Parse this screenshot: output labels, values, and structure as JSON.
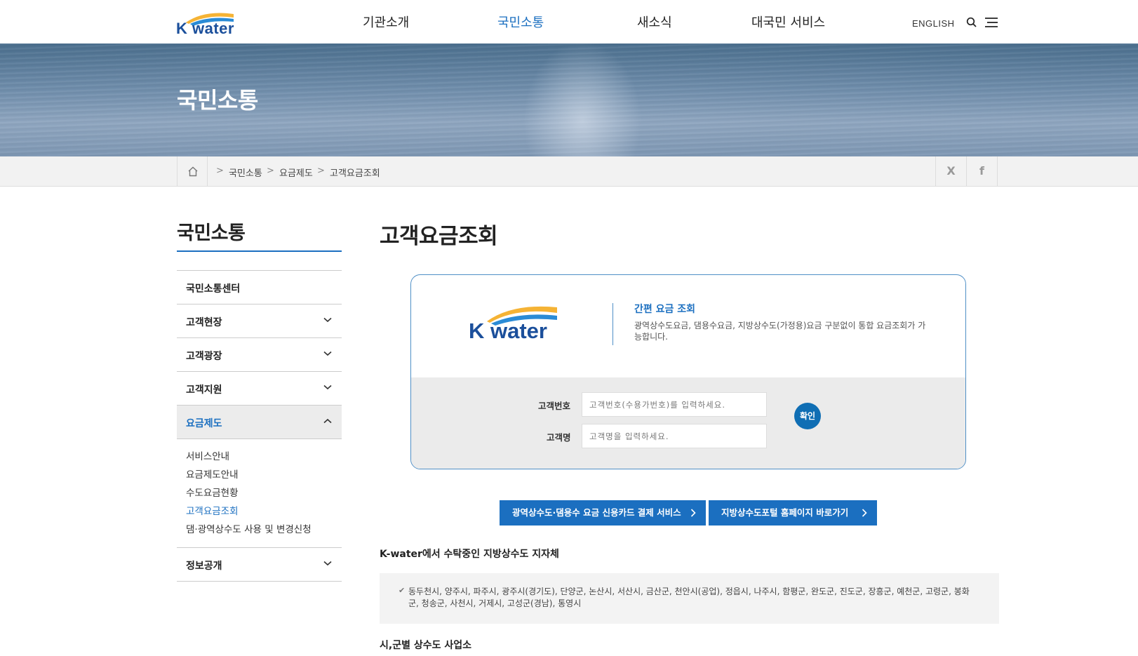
{
  "header": {
    "logo_text": "K water",
    "nav": [
      "기관소개",
      "국민소통",
      "새소식",
      "대국민 서비스"
    ],
    "active_nav_index": 1,
    "english_label": "ENGLISH"
  },
  "hero": {
    "title": "국민소통"
  },
  "breadcrumb": {
    "items": [
      "국민소통",
      "요금제도",
      "고객요금조회"
    ],
    "separator": ">",
    "share": {
      "x_label": "X",
      "facebook_label": "f"
    }
  },
  "sidebar": {
    "title": "국민소통",
    "items": [
      {
        "label": "국민소통센터"
      },
      {
        "label": "고객현장"
      },
      {
        "label": "고객광장"
      },
      {
        "label": "고객지원"
      },
      {
        "label": "요금제도"
      },
      {
        "label": "정보공개"
      }
    ],
    "sub_items": [
      "서비스안내",
      "요금제도안내",
      "수도요금현황",
      "고객요금조회",
      "댐·광역상수도 사용 및 변경신청"
    ],
    "active_sub_index": 3
  },
  "main": {
    "page_title": "고객요금조회",
    "lookup": {
      "logo_text": "K water",
      "heading": "간편 요금 조회",
      "description": "광역상수도요금, 댐용수요금, 지방상수도(가정용)요금 구분없이 통합 요금조회가 가능합니다.",
      "customer_no_label": "고객번호",
      "customer_no_placeholder": "고객번호(수용가번호)를 입력하세요.",
      "customer_name_label": "고객명",
      "customer_name_placeholder": "고객명을 입력하세요.",
      "confirm_label": "확인"
    },
    "buttons": {
      "card_payment": "광역상수도·댐용수 요금 신용카드 결제 서비스",
      "portal": "지방상수도포털 홈페이지 바로가기"
    },
    "consigned_heading": "K-water에서 수탁중인 지방상수도 지자체",
    "consigned_list": "동두천시, 양주시, 파주시, 광주시(경기도), 단양군, 논산시, 서산시, 금산군, 천안시(공업), 정읍시, 나주시, 함평군, 완도군, 진도군, 장흥군, 예천군, 고령군, 봉화군, 청송군, 사천시, 거제시, 고성군(경남), 통영시",
    "city_heading": "시,군별 상수도 사업소"
  },
  "colors": {
    "accent": "#1b6fc0",
    "brand": "#1b4f9b",
    "box_border": "#4f8fc6",
    "confirm": "#0f6eb4"
  }
}
